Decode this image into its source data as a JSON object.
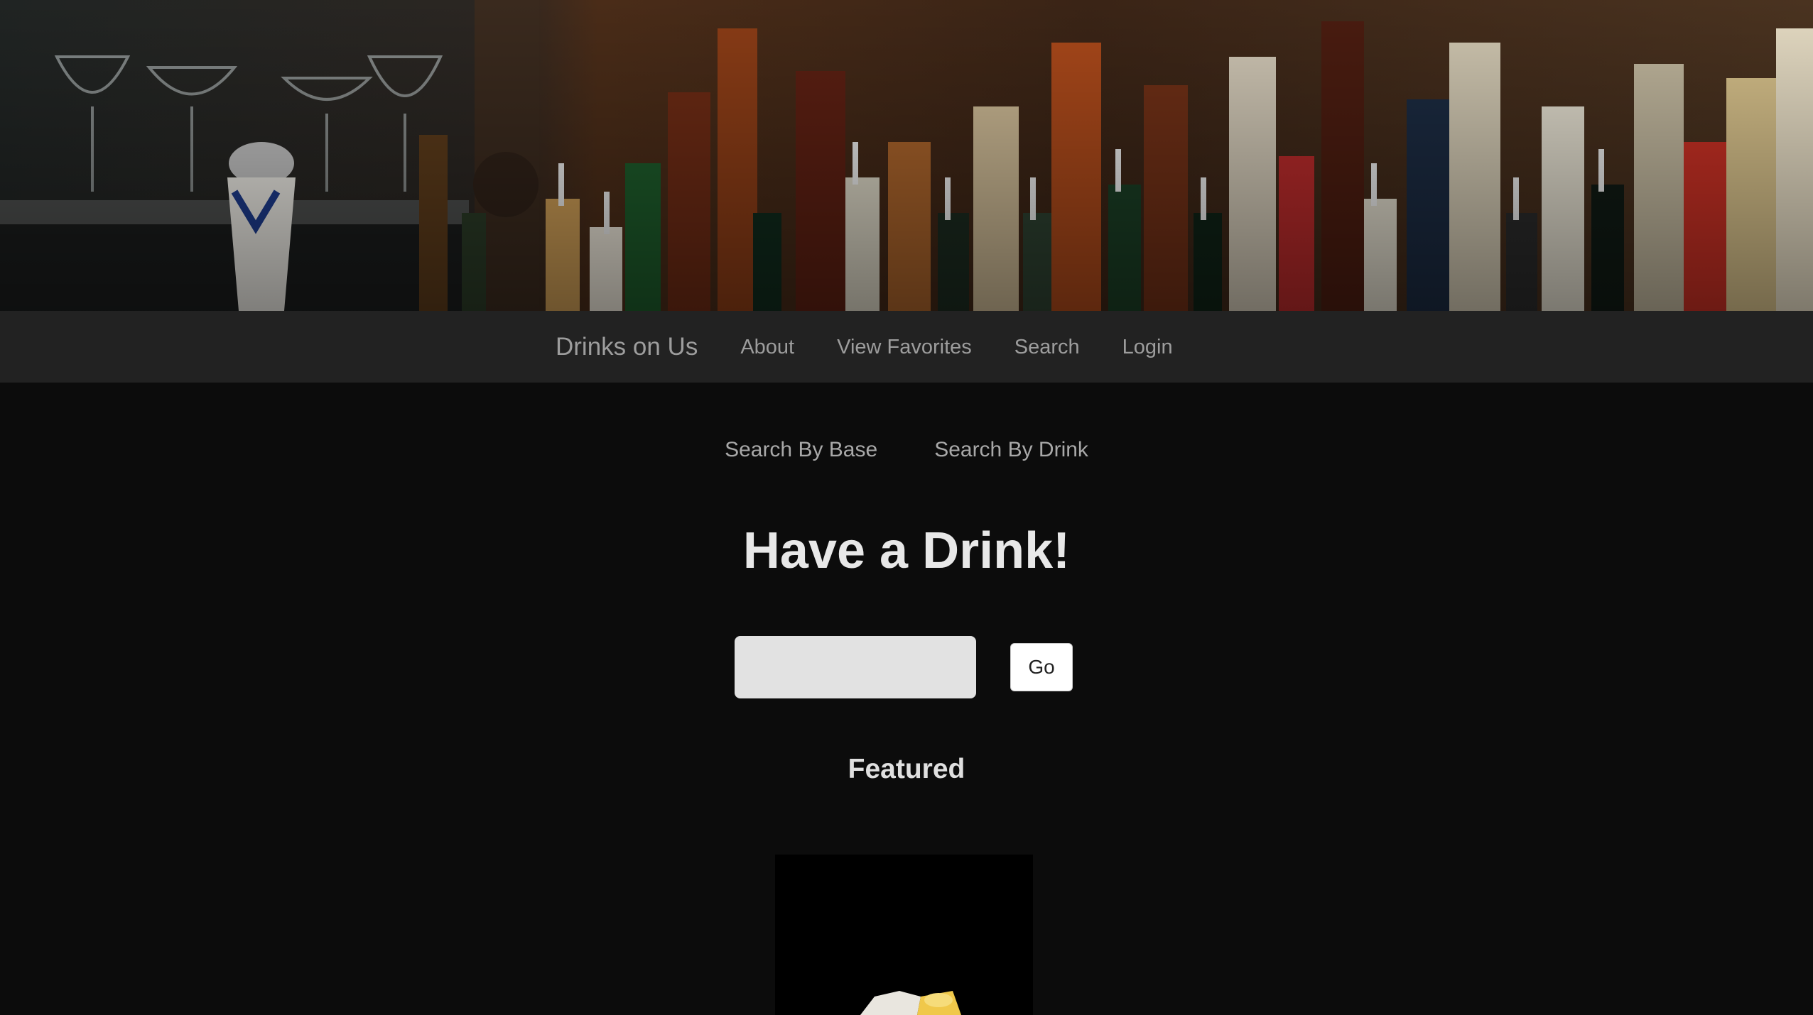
{
  "navbar": {
    "brand": "Drinks on Us",
    "links": [
      "About",
      "View Favorites",
      "Search",
      "Login"
    ]
  },
  "subnav": {
    "links": [
      "Search By Base",
      "Search By Drink"
    ]
  },
  "main": {
    "headline": "Have a Drink!",
    "search_value": "",
    "go_label": "Go",
    "featured_heading": "Featured"
  },
  "colors": {
    "page_background": "#0c0c0c",
    "navbar_background": "#222222",
    "nav_text": "#9d9d9d"
  }
}
